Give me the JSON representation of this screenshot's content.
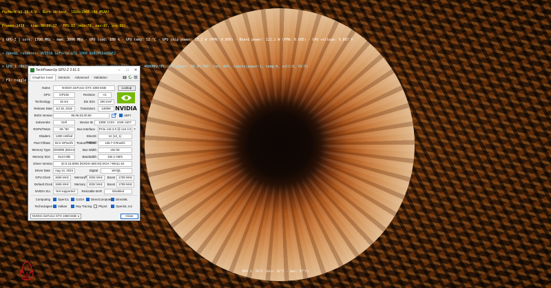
{
  "osd": {
    "line1": "FurMark v2.38.4.0 - Burn-in test, 1920x1080 (0X MSAA)",
    "line2": "Frames:1438 - time:00:00:17 - FPS:83 (min:78, max:87, avg:82)",
    "line3": "[ GPU-Z ] core: 1790 MHz - mem: 3000 MHz - GPU load: 100 % - GPU temp: 52 °C - GPU chip power: 92.2 W (PPW: 0.900) - Board power: 121.1 W (PPW: 0.685) - GPU voltage: 0.887 V",
    "line4": "> OpenGL renderer: NVIDIA GeForce GTX 1060 6GB/PCIe/SSE2",
    "line5": "> GPU 1 (NVIDIA GeForce GTX 1060 6GB) - core: 1683MHz/52°C/100%, mem: 4006MHz/9%, GPU power: 99.0% TDP, fan: 43%, limits(power:1, temp:0, volt:0, OV:0)",
    "line6": "- F1: toggle help"
  },
  "bottom_status": "GPU 1: 52°C (min: 32°C - max: 57°C)",
  "window": {
    "title": "TechPowerUp GPU-Z 2.61.0",
    "controls": {
      "minimize": "–",
      "maximize": "□",
      "close": "✕"
    },
    "tabs": [
      "Graphics Card",
      "Sensors",
      "Advanced",
      "Validation"
    ],
    "active_tab": "Graphics Card",
    "fields": {
      "name_label": "Name",
      "name_value": "NVIDIA GeForce GTX 1060 6GB",
      "lookup_button": "Lookup",
      "gpu_label": "GPU",
      "gpu_value": "GP106",
      "revision_label": "Revision",
      "revision_value": "A1",
      "technology_label": "Technology",
      "technology_value": "16 nm",
      "diesize_label": "Die Size",
      "diesize_value": "200 mm²",
      "release_label": "Release Date",
      "release_value": "Jul 19, 2016",
      "transistors_label": "Transistors",
      "transistors_value": "4400M",
      "bios_label": "BIOS Version",
      "bios_value": "86.06.63.00.56",
      "uefi_label": "UEFI",
      "subvendor_label": "Subvendor",
      "subvendor_value": "Dell",
      "deviceid_label": "Device ID",
      "deviceid_value": "10DE 1C03 - 1028 11D7",
      "rops_label": "ROPs/TMUs",
      "rops_value": "48 / 80",
      "businterface_label": "Bus Interface",
      "businterface_value": "PCIe x16 3.0 @ x16 3.0",
      "shaders_label": "Shaders",
      "shaders_value": "1280 Unified",
      "directx_label": "DirectX Support",
      "directx_value": "12 (12_1)",
      "pixelfill_label": "Pixel Fillrate",
      "pixelfill_value": "82.0 GPixel/s",
      "texturefill_label": "Texture Fillrate",
      "texturefill_value": "136.7 GTexel/s",
      "memtype_label": "Memory Type",
      "memtype_value": "GDDR5 (Micron)",
      "buswidth_label": "Bus Width",
      "buswidth_value": "192 bit",
      "memsize_label": "Memory Size",
      "memsize_value": "6144 MB",
      "bandwidth_label": "Bandwidth",
      "bandwidth_value": "192.2 GB/s",
      "driverver_label": "Driver Version",
      "driverver_value": "32.0.15.6094 (NVIDIA 560.94) DCH / Win11 64",
      "driverdate_label": "Driver Date",
      "driverdate_value": "Aug 14, 2024",
      "digsig_label": "Digital Signature",
      "digsig_value": "WHQL",
      "gpuclock_label": "GPU Clock",
      "gpuclock_value": "1506 MHz",
      "memory_label": "Memory",
      "gpuclock_mem_value": "2002 MHz",
      "boost_label": "Boost",
      "gpuclock_boost_value": "1709 MHz",
      "defclock_label": "Default Clock",
      "defclock_value": "1506 MHz",
      "defclock_mem_value": "2002 MHz",
      "defclock_boost_value": "1709 MHz",
      "sli_label": "NVIDIA SLI",
      "sli_value": "Not supported",
      "rebar_label": "Resizable BAR",
      "rebar_value": "Disabled",
      "computing_label": "Computing",
      "technologies_label": "Technologies"
    },
    "computing": [
      {
        "label": "OpenCL",
        "checked": true
      },
      {
        "label": "CUDA",
        "checked": true
      },
      {
        "label": "DirectCompute",
        "checked": true
      },
      {
        "label": "DirectML",
        "checked": true
      }
    ],
    "technologies": [
      {
        "label": "Vulkan",
        "checked": true
      },
      {
        "label": "Ray Tracing",
        "checked": true
      },
      {
        "label": "PhysX",
        "checked": false
      },
      {
        "label": "OpenGL 4.6",
        "checked": true
      }
    ],
    "gpu_select": "NVIDIA GeForce GTX 1060 6GB",
    "close_button": "Close"
  },
  "colors": {
    "accent": "#1a64c8",
    "nvidia_green": "#76b900",
    "osd_yellow": "#ffe600",
    "osd_cyan": "#60d8ff"
  }
}
